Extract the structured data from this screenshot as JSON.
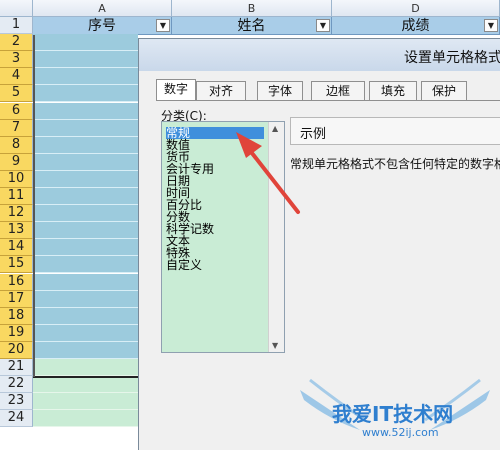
{
  "columns": {
    "a": "A",
    "b": "B",
    "d": "D"
  },
  "header_row": {
    "seq": "序号",
    "name": "姓名",
    "score": "成绩",
    "dropdown_glyph": "▼"
  },
  "row_numbers": [
    "1",
    "2",
    "3",
    "4",
    "5",
    "6",
    "7",
    "8",
    "9",
    "10",
    "11",
    "12",
    "13",
    "14",
    "15",
    "16",
    "17",
    "18",
    "19",
    "20",
    "21",
    "22",
    "23",
    "24"
  ],
  "selected_rows": {
    "from": "2",
    "to": "20"
  },
  "dialog": {
    "title": "设置单元格格式",
    "tabs": [
      "数字",
      "对齐",
      "字体",
      "边框",
      "填充",
      "保护"
    ],
    "active_tab": "数字",
    "category_label": "分类(C):",
    "categories": [
      "常规",
      "数值",
      "货币",
      "会计专用",
      "日期",
      "时间",
      "百分比",
      "分数",
      "科学记数",
      "文本",
      "特殊",
      "自定义"
    ],
    "selected_category": "常规",
    "sample_label": "示例",
    "description": "常规单元格格式不包含任何特定的数字格式。"
  },
  "watermark": {
    "text": "我爱IT技术网",
    "url": "www.52ij.com"
  },
  "colors": {
    "header_fill": "#a9cde8",
    "selected_rows": "#9ccbdd",
    "other_rows": "#c9ecd5",
    "arrow": "#e0443a"
  }
}
